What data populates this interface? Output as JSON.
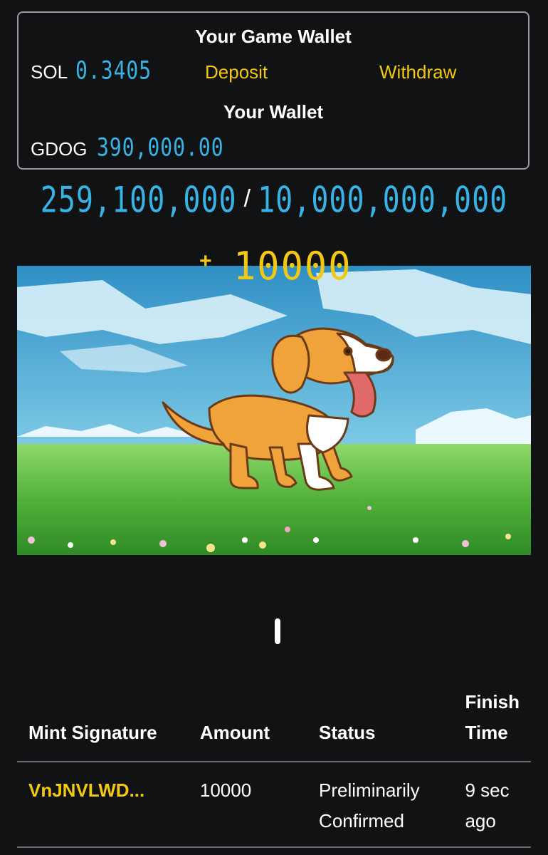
{
  "game_wallet": {
    "title": "Your Game Wallet",
    "currency": "SOL",
    "balance": "0.3405",
    "deposit_label": "Deposit",
    "withdraw_label": "Withdraw"
  },
  "wallet": {
    "title": "Your Wallet",
    "currency": "GDOG",
    "balance": "390,000.00"
  },
  "supply": {
    "minted": "259,100,000",
    "separator": "/",
    "total": "10,000,000,000"
  },
  "reward": {
    "plus": "+",
    "amount": "10000"
  },
  "colors": {
    "accent_yellow": "#f2c812",
    "digital_blue": "#37b3e6",
    "background": "#111214"
  },
  "mint_table": {
    "headers": {
      "signature": "Mint Signature",
      "amount": "Amount",
      "status": "Status",
      "finish_time": "Finish Time"
    },
    "rows": [
      {
        "signature": "VnJNVLWD...",
        "amount": "10000",
        "status": "Preliminarily Confirmed",
        "finish_time": "9 sec ago"
      }
    ]
  }
}
